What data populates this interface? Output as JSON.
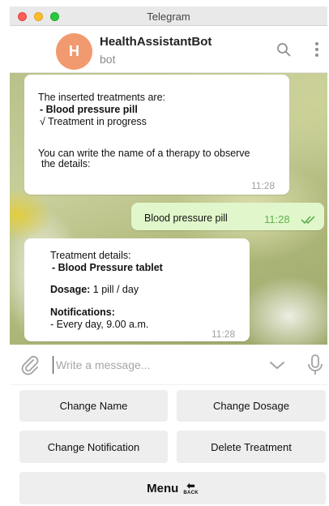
{
  "window": {
    "title": "Telegram"
  },
  "header": {
    "avatar_letter": "H",
    "name": "HealthAssistantBot",
    "status": "bot",
    "icons": [
      "search-icon",
      "more-vertical-icon"
    ]
  },
  "messages": [
    {
      "direction": "incoming",
      "lines": [
        "The inserted treatments are:",
        "- Blood pressure pill",
        "√ Treatment in progress",
        "You can write the name of a therapy to observe",
        "the details:"
      ],
      "time": "11:28"
    },
    {
      "direction": "outgoing",
      "text": "Blood pressure pill",
      "time": "11:28",
      "status_icon": "double-check-icon"
    },
    {
      "direction": "incoming",
      "lines": [
        "Treatment details:",
        "- Blood Pressure tablet",
        "Dosage:",
        " 1 pill / day",
        "Notifications:",
        "- Every day, 9.00 a.m."
      ],
      "time": "11:28"
    }
  ],
  "composer": {
    "placeholder": "Write a message...",
    "icons": [
      "paperclip-icon",
      "chevron-down-icon",
      "microphone-icon"
    ]
  },
  "keyboard": {
    "change_name": "Change Name",
    "change_dosage": "Change Dosage",
    "change_notification": "Change Notification",
    "delete_treatment": "Delete Treatment",
    "menu": "Menu",
    "back_icon_text": "BACK",
    "back_icon_arrow": "⬅"
  },
  "colors": {
    "avatar": "#f29a6f",
    "outgoing_bubble": "#e1f7cb",
    "outgoing_time": "#5fb14f"
  }
}
